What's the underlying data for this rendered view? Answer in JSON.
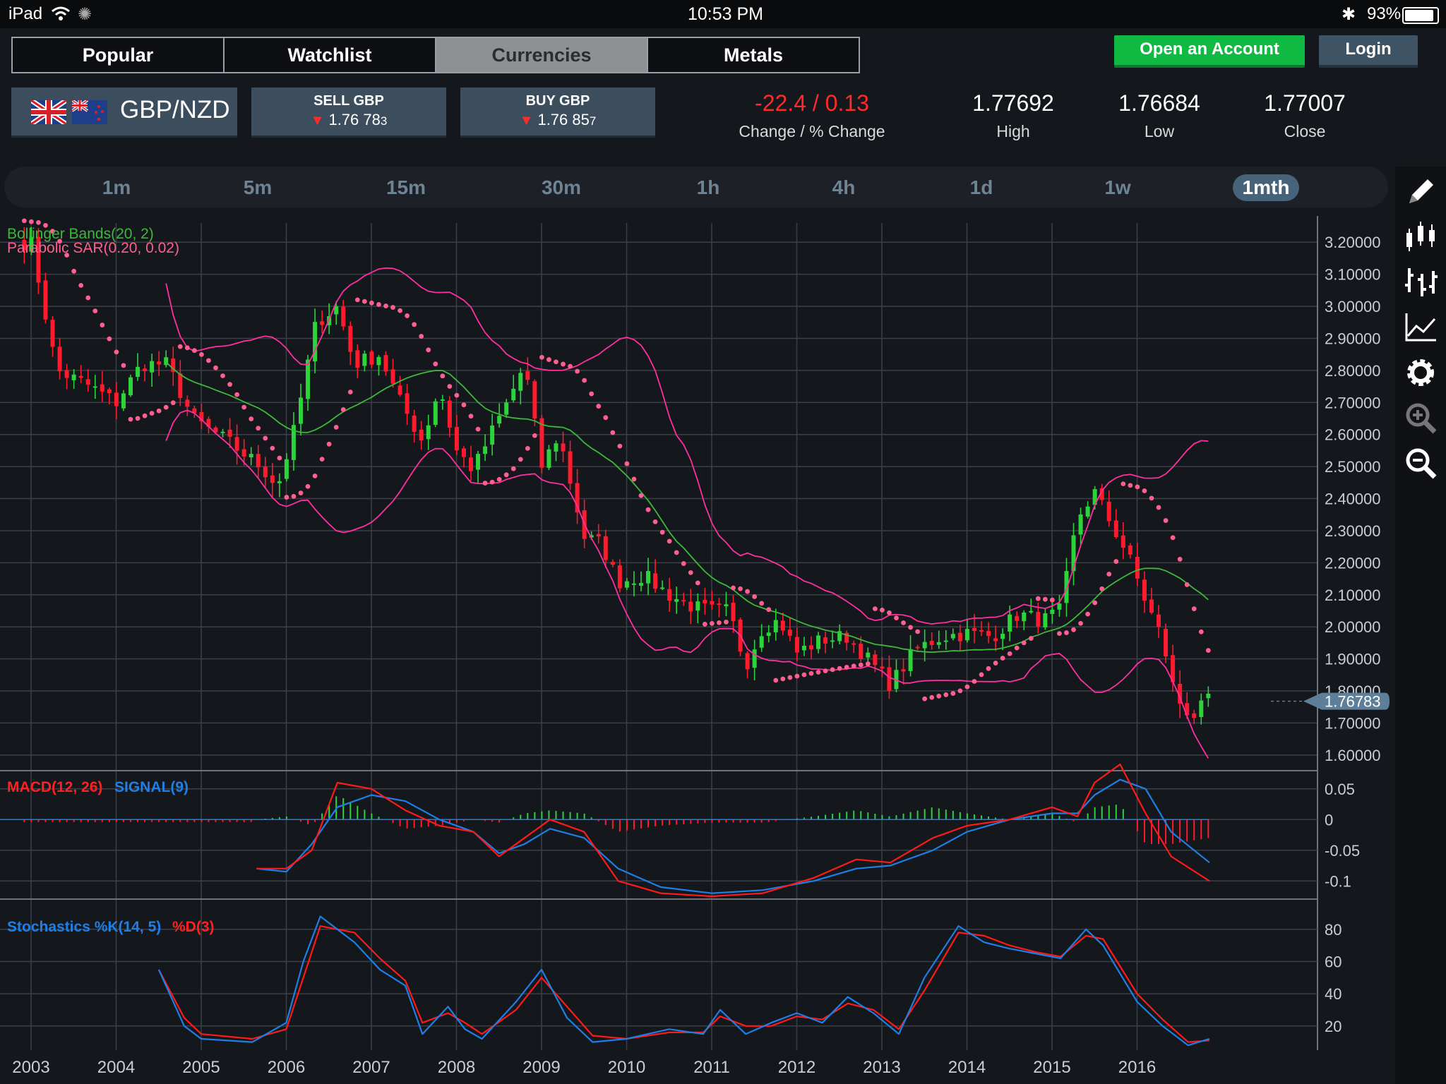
{
  "status_bar": {
    "device": "iPad",
    "time": "10:53 PM",
    "battery": "93%"
  },
  "tabs": [
    {
      "label": "Popular",
      "active": false
    },
    {
      "label": "Watchlist",
      "active": false
    },
    {
      "label": "Currencies",
      "active": true
    },
    {
      "label": "Metals",
      "active": false
    }
  ],
  "buttons": {
    "open_account": "Open an Account",
    "login": "Login"
  },
  "instrument": {
    "pair": "GBP/NZD",
    "flags": [
      "uk-flag-icon",
      "nz-flag-icon"
    ],
    "sell": {
      "label": "SELL GBP",
      "price_main": "1.76 78",
      "price_small": "3"
    },
    "buy": {
      "label": "BUY GBP",
      "price_main": "1.76 85",
      "price_small": "7"
    },
    "change": {
      "value": "-22.4 / 0.13",
      "label": "Change / % Change"
    },
    "high": {
      "value": "1.77692",
      "label": "High"
    },
    "low": {
      "value": "1.76684",
      "label": "Low"
    },
    "close": {
      "value": "1.77007",
      "label": "Close"
    }
  },
  "timeframes": [
    {
      "label": "1m",
      "active": false
    },
    {
      "label": "5m",
      "active": false
    },
    {
      "label": "15m",
      "active": false
    },
    {
      "label": "30m",
      "active": false
    },
    {
      "label": "1h",
      "active": false
    },
    {
      "label": "4h",
      "active": false
    },
    {
      "label": "1d",
      "active": false
    },
    {
      "label": "1w",
      "active": false
    },
    {
      "label": "1mth",
      "active": true
    }
  ],
  "toolbar": [
    "pencil-icon",
    "candlestick-icon",
    "ohlc-bars-icon",
    "line-chart-icon",
    "gear-icon",
    "zoom-in-icon",
    "zoom-out-icon"
  ],
  "colors": {
    "up": "#2cd33a",
    "down": "#ff1a2e",
    "bollinger_mid": "#3db83a",
    "bollinger_band": "#ff2fa0",
    "sar": "#ff5f8f",
    "macd": "#ff1a1a",
    "signal": "#1e7fe6",
    "stoch_k": "#1e7fe6",
    "stoch_d": "#ff1a1a",
    "price_tag": "#5d7f9a"
  },
  "chart_data": [
    {
      "type": "candlestick",
      "title": "",
      "x_range": [
        2002.9,
        2016.9
      ],
      "x_ticks": [
        "2003",
        "2004",
        "2005",
        "2006",
        "2007",
        "2008",
        "2009",
        "2010",
        "2011",
        "2012",
        "2013",
        "2014",
        "2015",
        "2016"
      ],
      "y_range": [
        1.56,
        3.26
      ],
      "y_ticks": [
        "3.20000",
        "3.10000",
        "3.00000",
        "2.90000",
        "2.80000",
        "2.70000",
        "2.60000",
        "2.50000",
        "2.40000",
        "2.30000",
        "2.20000",
        "2.10000",
        "2.00000",
        "1.90000",
        "1.80000",
        "1.70000",
        "1.60000"
      ],
      "current_price": "1.76783",
      "indicators": [
        "Bollinger Bands(20, 2)",
        "Parabolic SAR(0.20, 0.02)"
      ],
      "close_keypoints": [
        [
          2003.0,
          3.2
        ],
        [
          2003.3,
          2.8
        ],
        [
          2003.7,
          2.75
        ],
        [
          2004.0,
          2.7
        ],
        [
          2004.3,
          2.82
        ],
        [
          2004.6,
          2.82
        ],
        [
          2004.9,
          2.65
        ],
        [
          2005.3,
          2.58
        ],
        [
          2005.7,
          2.5
        ],
        [
          2005.9,
          2.44
        ],
        [
          2006.1,
          2.62
        ],
        [
          2006.35,
          2.95
        ],
        [
          2006.6,
          3.0
        ],
        [
          2006.8,
          2.82
        ],
        [
          2007.1,
          2.85
        ],
        [
          2007.3,
          2.72
        ],
        [
          2007.6,
          2.58
        ],
        [
          2007.8,
          2.75
        ],
        [
          2008.0,
          2.55
        ],
        [
          2008.2,
          2.49
        ],
        [
          2008.4,
          2.6
        ],
        [
          2008.6,
          2.7
        ],
        [
          2008.8,
          2.82
        ],
        [
          2009.0,
          2.5
        ],
        [
          2009.2,
          2.6
        ],
        [
          2009.5,
          2.28
        ],
        [
          2009.7,
          2.26
        ],
        [
          2009.9,
          2.14
        ],
        [
          2010.2,
          2.16
        ],
        [
          2010.5,
          2.1
        ],
        [
          2010.8,
          2.06
        ],
        [
          2011.0,
          2.05
        ],
        [
          2011.2,
          2.05
        ],
        [
          2011.4,
          1.88
        ],
        [
          2011.6,
          2.0
        ],
        [
          2011.8,
          2.02
        ],
        [
          2012.0,
          1.92
        ],
        [
          2012.3,
          1.96
        ],
        [
          2012.6,
          1.97
        ],
        [
          2012.9,
          1.88
        ],
        [
          2013.1,
          1.82
        ],
        [
          2013.4,
          1.93
        ],
        [
          2013.7,
          1.97
        ],
        [
          2014.0,
          1.98
        ],
        [
          2014.3,
          1.97
        ],
        [
          2014.6,
          2.04
        ],
        [
          2014.9,
          2.02
        ],
        [
          2015.1,
          2.05
        ],
        [
          2015.3,
          2.34
        ],
        [
          2015.5,
          2.42
        ],
        [
          2015.7,
          2.32
        ],
        [
          2015.9,
          2.22
        ],
        [
          2016.1,
          2.08
        ],
        [
          2016.3,
          1.96
        ],
        [
          2016.45,
          1.78
        ],
        [
          2016.65,
          1.72
        ],
        [
          2016.85,
          1.77
        ]
      ]
    },
    {
      "type": "line",
      "title": "",
      "series_labels": [
        "MACD(12, 26)",
        "SIGNAL(9)"
      ],
      "y_range": [
        -0.125,
        0.075
      ],
      "y_ticks": [
        "0.05",
        "0",
        "-0.05",
        "-0.1"
      ],
      "macd_keypoints": [
        [
          2005.65,
          -0.08
        ],
        [
          2006.0,
          -0.08
        ],
        [
          2006.3,
          -0.05
        ],
        [
          2006.6,
          0.06
        ],
        [
          2007.0,
          0.05
        ],
        [
          2007.4,
          0.015
        ],
        [
          2007.8,
          -0.01
        ],
        [
          2008.2,
          -0.02
        ],
        [
          2008.5,
          -0.06
        ],
        [
          2008.8,
          -0.03
        ],
        [
          2009.1,
          0.0
        ],
        [
          2009.5,
          -0.02
        ],
        [
          2009.9,
          -0.1
        ],
        [
          2010.4,
          -0.12
        ],
        [
          2011.0,
          -0.125
        ],
        [
          2011.6,
          -0.12
        ],
        [
          2012.2,
          -0.095
        ],
        [
          2012.7,
          -0.065
        ],
        [
          2013.1,
          -0.07
        ],
        [
          2013.6,
          -0.03
        ],
        [
          2014.0,
          -0.01
        ],
        [
          2014.5,
          0.0
        ],
        [
          2015.0,
          0.02
        ],
        [
          2015.3,
          0.005
        ],
        [
          2015.5,
          0.06
        ],
        [
          2015.8,
          0.09
        ],
        [
          2016.1,
          0.01
        ],
        [
          2016.4,
          -0.06
        ],
        [
          2016.85,
          -0.1
        ]
      ],
      "signal_keypoints": [
        [
          2005.65,
          -0.08
        ],
        [
          2006.0,
          -0.085
        ],
        [
          2006.3,
          -0.04
        ],
        [
          2006.6,
          0.02
        ],
        [
          2007.0,
          0.04
        ],
        [
          2007.4,
          0.03
        ],
        [
          2007.8,
          0.0
        ],
        [
          2008.2,
          -0.02
        ],
        [
          2008.5,
          -0.055
        ],
        [
          2008.8,
          -0.04
        ],
        [
          2009.1,
          -0.015
        ],
        [
          2009.5,
          -0.03
        ],
        [
          2009.9,
          -0.08
        ],
        [
          2010.4,
          -0.11
        ],
        [
          2011.0,
          -0.12
        ],
        [
          2011.6,
          -0.115
        ],
        [
          2012.2,
          -0.1
        ],
        [
          2012.7,
          -0.08
        ],
        [
          2013.1,
          -0.075
        ],
        [
          2013.6,
          -0.05
        ],
        [
          2014.0,
          -0.02
        ],
        [
          2014.5,
          0.0
        ],
        [
          2015.0,
          0.01
        ],
        [
          2015.3,
          0.01
        ],
        [
          2015.5,
          0.04
        ],
        [
          2015.8,
          0.065
        ],
        [
          2016.1,
          0.05
        ],
        [
          2016.4,
          -0.02
        ],
        [
          2016.85,
          -0.07
        ]
      ]
    },
    {
      "type": "line",
      "title": "",
      "series_labels": [
        "Stochastics %K(14, 5)",
        "%D(3)"
      ],
      "y_range": [
        5,
        97
      ],
      "y_ticks": [
        "80",
        "60",
        "40",
        "20"
      ],
      "k_keypoints": [
        [
          2004.5,
          55
        ],
        [
          2004.8,
          20
        ],
        [
          2005.0,
          12
        ],
        [
          2005.6,
          10
        ],
        [
          2006.0,
          22
        ],
        [
          2006.2,
          60
        ],
        [
          2006.4,
          88
        ],
        [
          2006.8,
          72
        ],
        [
          2007.1,
          55
        ],
        [
          2007.4,
          45
        ],
        [
          2007.6,
          15
        ],
        [
          2007.9,
          32
        ],
        [
          2008.1,
          18
        ],
        [
          2008.3,
          12
        ],
        [
          2008.7,
          35
        ],
        [
          2009.0,
          55
        ],
        [
          2009.3,
          25
        ],
        [
          2009.6,
          10
        ],
        [
          2010.0,
          12
        ],
        [
          2010.5,
          18
        ],
        [
          2010.9,
          15
        ],
        [
          2011.1,
          30
        ],
        [
          2011.4,
          15
        ],
        [
          2011.7,
          22
        ],
        [
          2012.0,
          28
        ],
        [
          2012.3,
          22
        ],
        [
          2012.6,
          38
        ],
        [
          2012.9,
          28
        ],
        [
          2013.2,
          15
        ],
        [
          2013.5,
          50
        ],
        [
          2013.9,
          82
        ],
        [
          2014.2,
          72
        ],
        [
          2014.5,
          68
        ],
        [
          2014.8,
          65
        ],
        [
          2015.1,
          62
        ],
        [
          2015.4,
          80
        ],
        [
          2015.6,
          70
        ],
        [
          2016.0,
          35
        ],
        [
          2016.3,
          20
        ],
        [
          2016.6,
          8
        ],
        [
          2016.85,
          12
        ]
      ],
      "d_keypoints": [
        [
          2004.5,
          55
        ],
        [
          2004.8,
          25
        ],
        [
          2005.0,
          15
        ],
        [
          2005.6,
          12
        ],
        [
          2006.0,
          18
        ],
        [
          2006.2,
          50
        ],
        [
          2006.4,
          82
        ],
        [
          2006.8,
          78
        ],
        [
          2007.1,
          62
        ],
        [
          2007.4,
          48
        ],
        [
          2007.6,
          22
        ],
        [
          2007.9,
          28
        ],
        [
          2008.1,
          22
        ],
        [
          2008.3,
          15
        ],
        [
          2008.7,
          30
        ],
        [
          2009.0,
          50
        ],
        [
          2009.3,
          32
        ],
        [
          2009.6,
          14
        ],
        [
          2010.0,
          12
        ],
        [
          2010.5,
          16
        ],
        [
          2010.9,
          16
        ],
        [
          2011.1,
          26
        ],
        [
          2011.4,
          20
        ],
        [
          2011.7,
          20
        ],
        [
          2012.0,
          26
        ],
        [
          2012.3,
          24
        ],
        [
          2012.6,
          34
        ],
        [
          2012.9,
          30
        ],
        [
          2013.2,
          18
        ],
        [
          2013.5,
          42
        ],
        [
          2013.9,
          78
        ],
        [
          2014.2,
          76
        ],
        [
          2014.5,
          70
        ],
        [
          2014.8,
          66
        ],
        [
          2015.1,
          63
        ],
        [
          2015.4,
          76
        ],
        [
          2015.6,
          74
        ],
        [
          2016.0,
          40
        ],
        [
          2016.3,
          24
        ],
        [
          2016.6,
          10
        ],
        [
          2016.85,
          11
        ]
      ]
    }
  ]
}
